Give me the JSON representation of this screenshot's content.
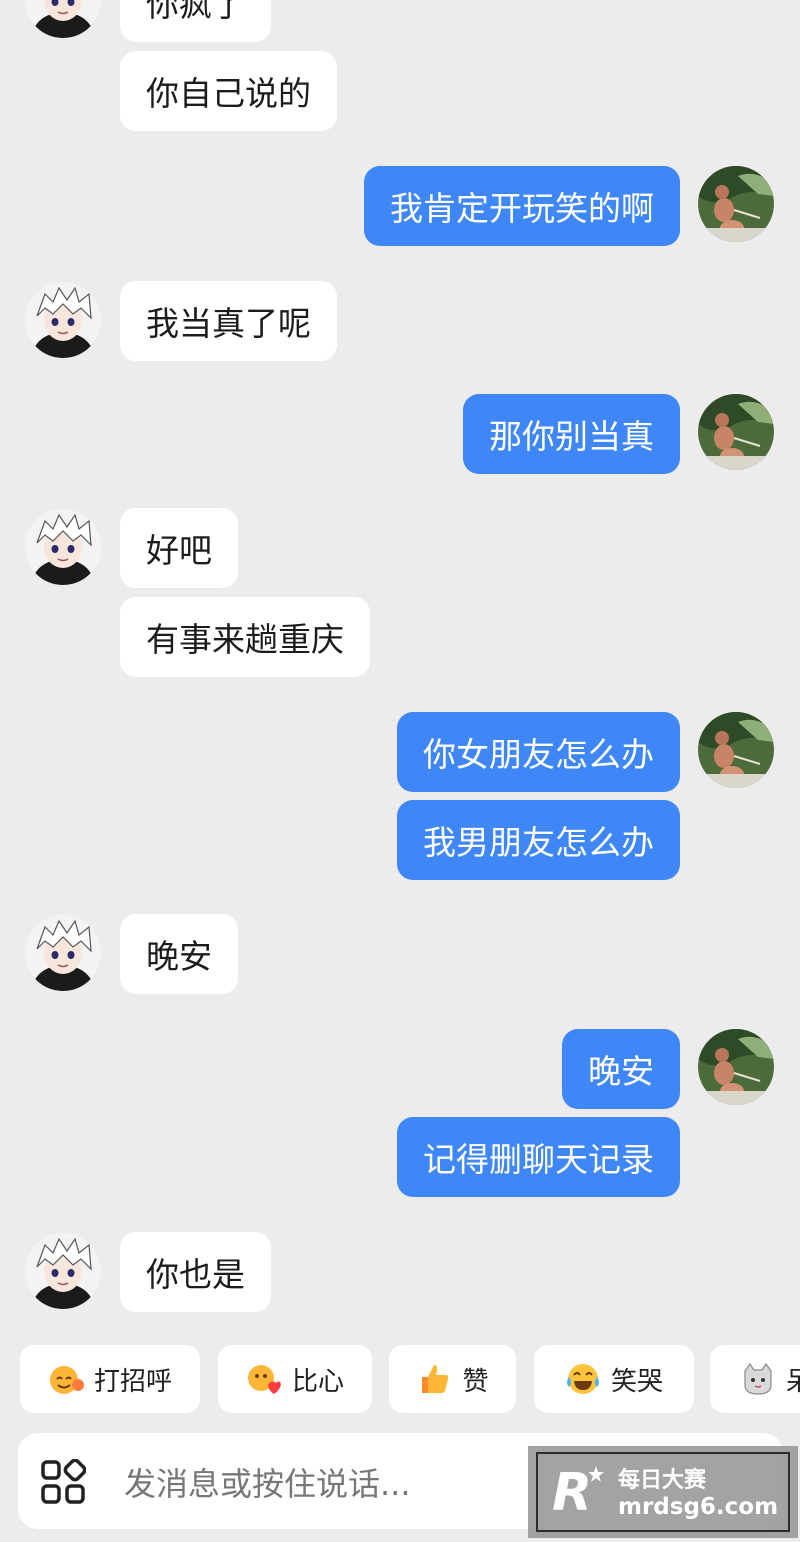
{
  "messages": [
    {
      "side": "in",
      "text": "你疯了"
    },
    {
      "side": "in",
      "text": "你自己说的"
    },
    {
      "side": "out",
      "text": "我肯定开玩笑的啊"
    },
    {
      "side": "in",
      "text": "我当真了呢"
    },
    {
      "side": "out",
      "text": "那你别当真"
    },
    {
      "side": "in",
      "text": "好吧"
    },
    {
      "side": "in",
      "text": "有事来趟重庆"
    },
    {
      "side": "out",
      "text": "你女朋友怎么办"
    },
    {
      "side": "out",
      "text": "我男朋友怎么办"
    },
    {
      "side": "in",
      "text": "晚安"
    },
    {
      "side": "out",
      "text": "晚安"
    },
    {
      "side": "out",
      "text": "记得删聊天记录"
    },
    {
      "side": "in",
      "text": "你也是"
    }
  ],
  "quick_replies": [
    {
      "label": "打招呼",
      "icon": "wave-face-icon"
    },
    {
      "label": "比心",
      "icon": "heart-hands-icon"
    },
    {
      "label": "赞",
      "icon": "thumbs-up-icon"
    },
    {
      "label": "笑哭",
      "icon": "laugh-cry-icon"
    },
    {
      "label": "呆",
      "icon": "cat-face-icon"
    }
  ],
  "input": {
    "placeholder": "发消息或按住说话..."
  },
  "watermark": {
    "cn": "每日大赛",
    "url": "mrdsg6.com",
    "logo_letter": "R"
  },
  "colors": {
    "outgoing": "#3f87f7",
    "incoming": "#ffffff",
    "background": "#ececed"
  }
}
